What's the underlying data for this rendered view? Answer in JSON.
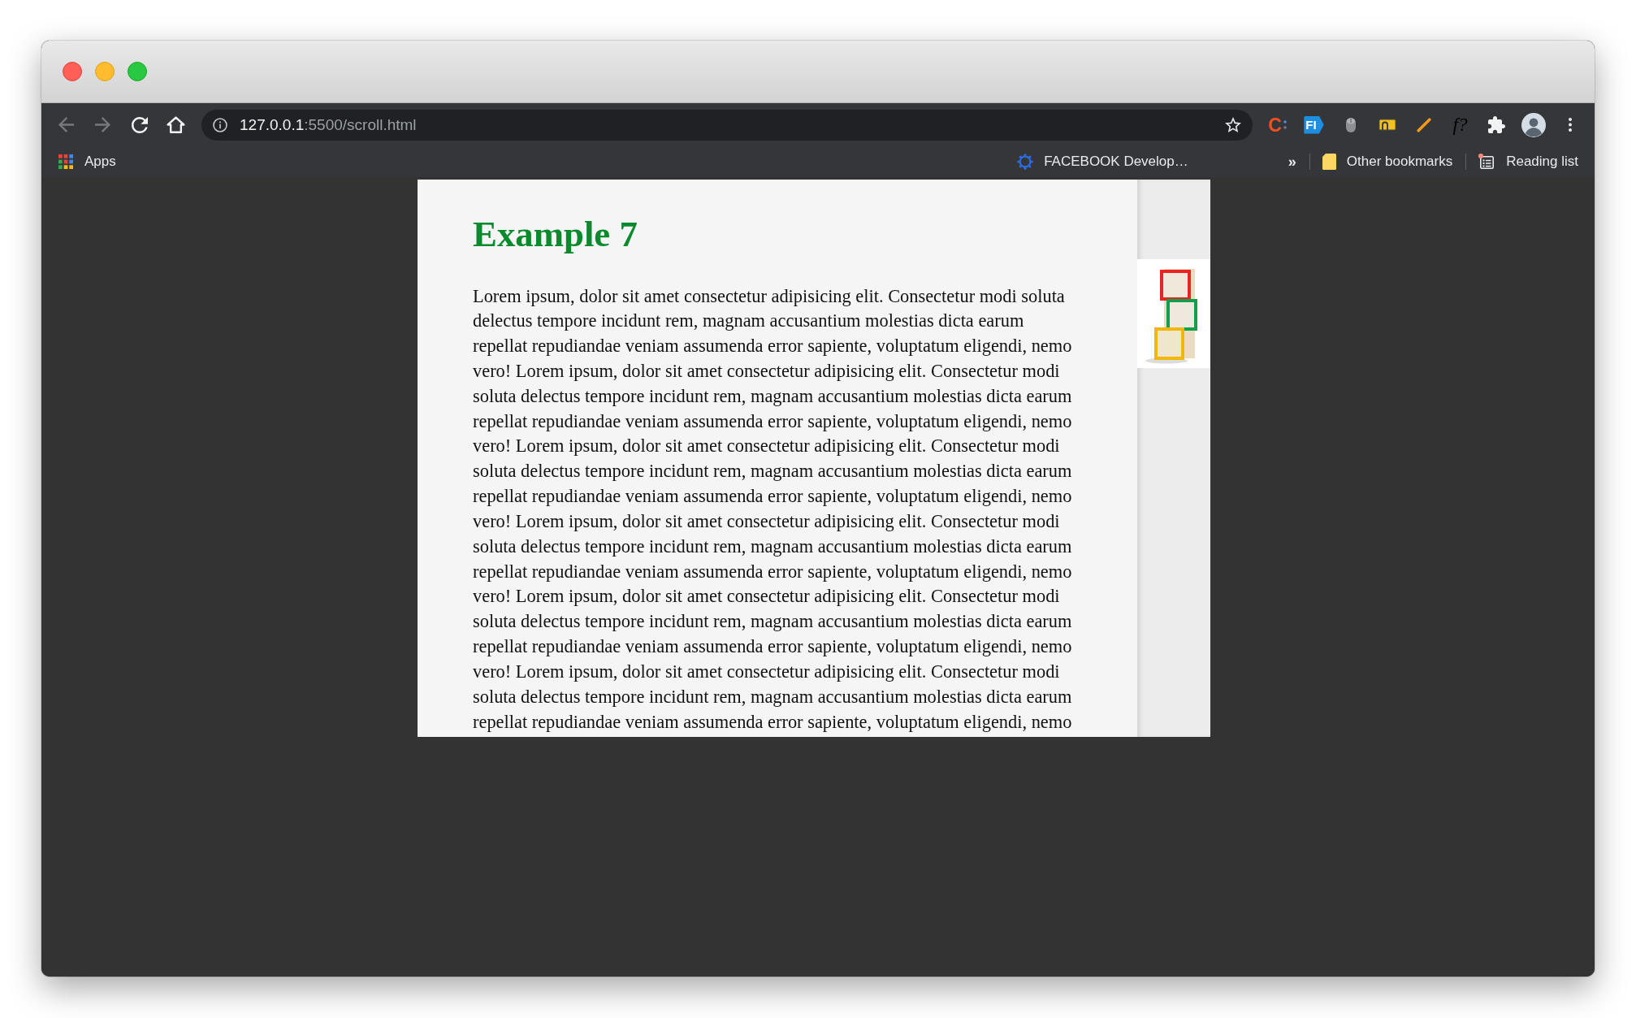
{
  "toolbar": {
    "nav_buttons": [
      {
        "kind": "back",
        "disabled": true
      },
      {
        "kind": "forward",
        "disabled": true
      },
      {
        "kind": "reload",
        "disabled": false
      },
      {
        "kind": "home",
        "disabled": false
      }
    ],
    "address_bar": {
      "host": "127.0.0.1",
      "path": ":5500/scroll.html"
    },
    "extensions": [
      {
        "kind": "letter",
        "label": "C"
      },
      {
        "kind": "badge",
        "label": "FI"
      },
      {
        "kind": "mouse"
      },
      {
        "kind": "tile"
      },
      {
        "kind": "pencil"
      },
      {
        "kind": "script",
        "label": "f?"
      },
      {
        "kind": "puzzle"
      },
      {
        "kind": "avatar"
      },
      {
        "kind": "menu"
      }
    ]
  },
  "bookmarks_bar": {
    "items": [
      {
        "kind": "apps",
        "label": "Apps"
      },
      {
        "kind": "site",
        "label": "FACEBOOK Develop…"
      },
      {
        "kind": "overflow",
        "label": "»"
      },
      {
        "kind": "folder",
        "label": "Other bookmarks"
      },
      {
        "kind": "reading-list",
        "label": "Reading list",
        "unread": true
      }
    ]
  },
  "page": {
    "heading": "Example 7",
    "paragraph": "Lorem ipsum, dolor sit amet consectetur adipisicing elit. Consectetur modi soluta delectus tempore incidunt rem, magnam accusantium molestias dicta earum repellat repudiandae veniam assumenda error sapiente, voluptatum eligendi, nemo vero! Lorem ipsum, dolor sit amet consectetur adipisicing elit. Consectetur modi soluta delectus tempore incidunt rem, magnam accusantium molestias dicta earum repellat repudiandae veniam assumenda error sapiente, voluptatum eligendi, nemo vero! Lorem ipsum, dolor sit amet consectetur adipisicing elit. Consectetur modi soluta delectus tempore incidunt rem, magnam accusantium molestias dicta earum repellat repudiandae veniam assumenda error sapiente, voluptatum eligendi, nemo vero! Lorem ipsum, dolor sit amet consectetur adipisicing elit. Consectetur modi soluta delectus tempore incidunt rem, magnam accusantium molestias dicta earum repellat repudiandae veniam assumenda error sapiente, voluptatum eligendi, nemo vero! Lorem ipsum, dolor sit amet consectetur adipisicing elit. Consectetur modi soluta delectus tempore incidunt rem, magnam accusantium molestias dicta earum repellat repudiandae veniam assumenda error sapiente, voluptatum eligendi, nemo vero! Lorem ipsum, dolor sit amet consectetur adipisicing elit. Consectetur modi soluta delectus tempore incidunt rem, magnam accusantium molestias dicta earum repellat repudiandae veniam assumenda error sapiente, voluptatum eligendi, nemo"
  }
}
